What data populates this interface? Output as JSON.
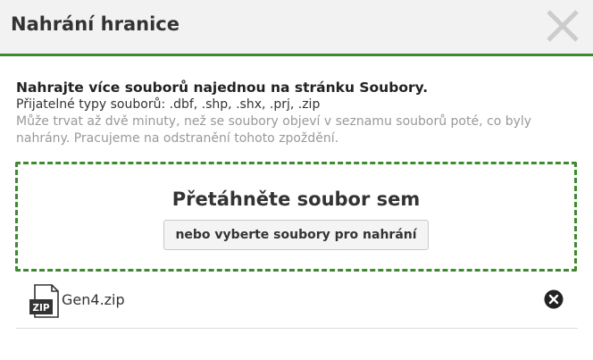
{
  "dialog": {
    "title": "Nahrání hranice",
    "close_icon": "close-icon"
  },
  "instructions": {
    "lead": "Nahrajte více souborů najednou na stránku Soubory.",
    "accepted_types": "Přijatelné typy souborů: .dbf, .shp, .shx, .prj, .zip",
    "note": "Může trvat až dvě minuty, než se soubory objeví v seznamu souborů poté, co byly nahrány. Pracujeme na odstranění tohoto zpoždění."
  },
  "dropzone": {
    "title": "Přetáhněte soubor sem",
    "browse_label": "nebo vyberte soubory pro nahrání"
  },
  "files": [
    {
      "name": "Gen4.zip",
      "icon": "zip-file-icon",
      "icon_text": "ZIP",
      "remove_icon": "remove-circle-icon"
    }
  ],
  "colors": {
    "accent": "#3e8a2e",
    "header_bg": "#f2f2f2",
    "muted_text": "#999999"
  }
}
